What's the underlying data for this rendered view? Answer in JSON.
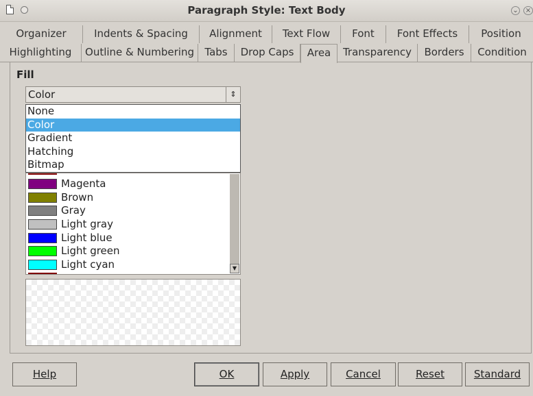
{
  "window": {
    "title": "Paragraph Style: Text Body"
  },
  "tabs": {
    "row1": [
      "Organizer",
      "Indents & Spacing",
      "Alignment",
      "Text Flow",
      "Font",
      "Font Effects",
      "Position"
    ],
    "row2": [
      "Highlighting",
      "Outline & Numbering",
      "Tabs",
      "Drop Caps",
      "Area",
      "Transparency",
      "Borders",
      "Condition"
    ],
    "active": "Area"
  },
  "fill": {
    "label": "Fill",
    "selected": "Color",
    "options": [
      "None",
      "Color",
      "Gradient",
      "Hatching",
      "Bitmap"
    ],
    "colors": [
      {
        "name": "Magenta",
        "hex": "#800080"
      },
      {
        "name": "Brown",
        "hex": "#808000"
      },
      {
        "name": "Gray",
        "hex": "#808080"
      },
      {
        "name": "Light gray",
        "hex": "#c0c0c0"
      },
      {
        "name": "Light blue",
        "hex": "#0000ff"
      },
      {
        "name": "Light green",
        "hex": "#00ff00"
      },
      {
        "name": "Light cyan",
        "hex": "#00ffff"
      }
    ]
  },
  "buttons": {
    "help": "Help",
    "ok": "OK",
    "apply": "Apply",
    "cancel": "Cancel",
    "reset": "Reset",
    "standard": "Standard"
  },
  "colors": {
    "selection": "#4ba9e4",
    "background": "#d6d2cc"
  }
}
